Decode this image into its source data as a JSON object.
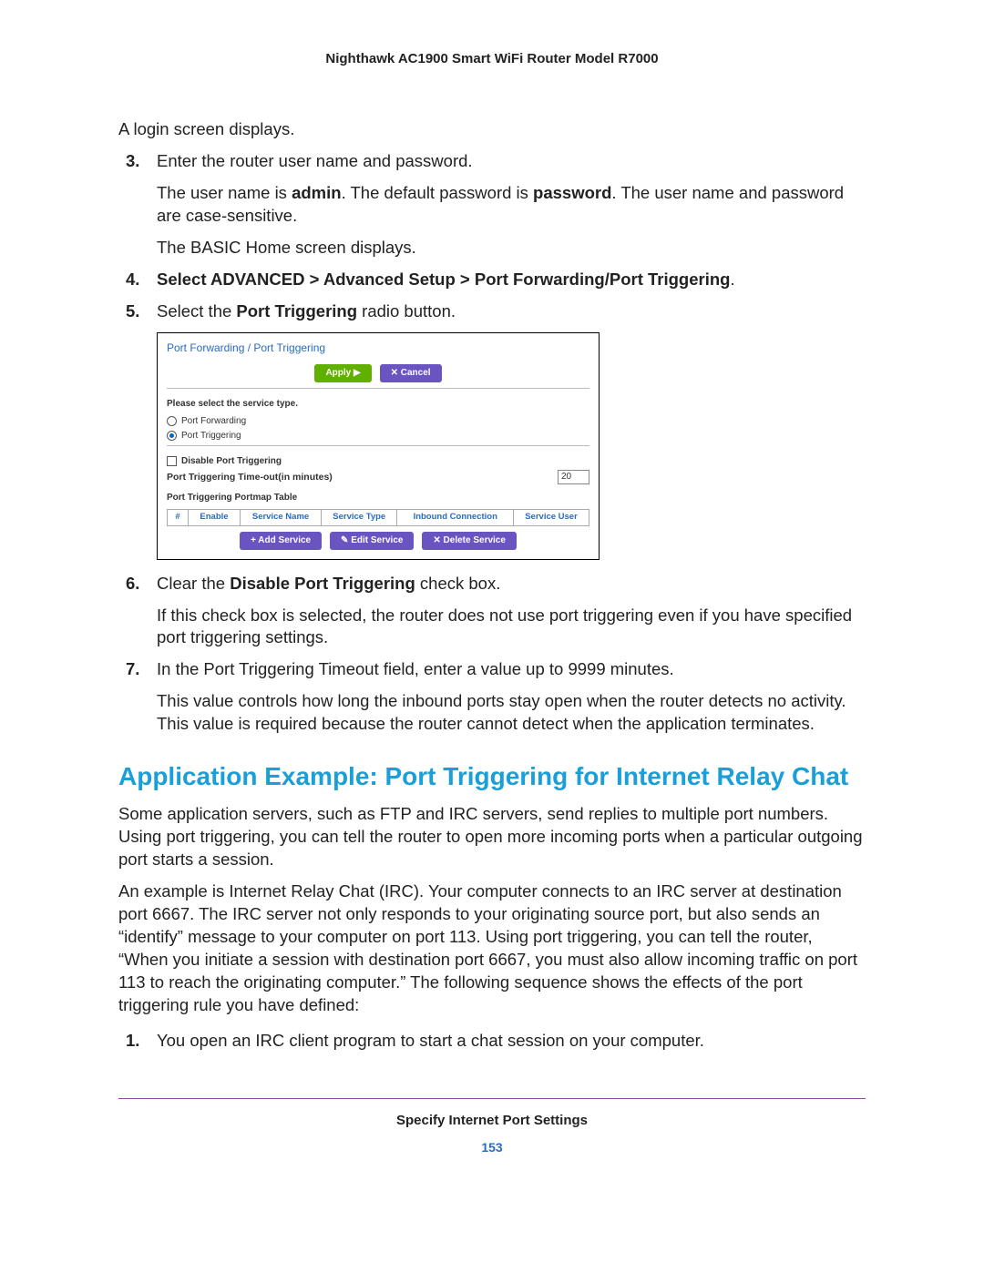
{
  "header": {
    "title": "Nighthawk AC1900 Smart WiFi Router Model R7000"
  },
  "intro": {
    "login_displays": "A login screen displays."
  },
  "steps": {
    "s3": {
      "num": "3.",
      "text": "Enter the router user name and password.",
      "detail_pre": "The user name is ",
      "admin": "admin",
      "detail_mid": ". The default password is ",
      "password": "password",
      "detail_post": ". The user name and password are case-sensitive.",
      "basic": "The BASIC Home screen displays."
    },
    "s4": {
      "num": "4.",
      "pre": "Select ",
      "path": "ADVANCED > Advanced Setup > Port Forwarding/Port Triggering",
      "post": "."
    },
    "s5": {
      "num": "5.",
      "pre": "Select the ",
      "bold": "Port Triggering",
      "post": " radio button."
    },
    "s6": {
      "num": "6.",
      "pre": "Clear the ",
      "bold": "Disable Port Triggering",
      "post": " check box.",
      "detail": "If this check box is selected, the router does not use port triggering even if you have specified port triggering settings."
    },
    "s7": {
      "num": "7.",
      "text": "In the Port Triggering Timeout field, enter a value up to 9999 minutes.",
      "detail": "This value controls how long the inbound ports stay open when the router detects no activity. This value is required because the router cannot detect when the application terminates."
    }
  },
  "figure": {
    "panel_title": "Port Forwarding / Port Triggering",
    "apply": "Apply ▶",
    "cancel": "✕ Cancel",
    "select_service": "Please select the service type.",
    "radio1": "Port Forwarding",
    "radio2": "Port Triggering",
    "disable_label": "Disable Port Triggering",
    "timeout_label": "Port Triggering Time-out(in minutes)",
    "timeout_value": "20",
    "portmap_label": "Port Triggering Portmap Table",
    "cols": {
      "hash": "#",
      "enable": "Enable",
      "service_name": "Service Name",
      "service_type": "Service Type",
      "inbound": "Inbound Connection",
      "service_user": "Service User"
    },
    "add": "+ Add Service",
    "edit": "✎ Edit Service",
    "del": "✕ Delete Service"
  },
  "section": {
    "heading": "Application Example: Port Triggering for Internet Relay Chat",
    "p1": "Some application servers, such as FTP and IRC servers, send replies to multiple port numbers. Using port triggering, you can tell the router to open more incoming ports when a particular outgoing port starts a session.",
    "p2": "An example is Internet Relay Chat (IRC). Your computer connects to an IRC server at destination port 6667. The IRC server not only responds to your originating source port, but also sends an “identify” message to your computer on port 113. Using port triggering, you can tell the router, “When you initiate a session with destination port 6667, you must also allow incoming traffic on port 113 to reach the originating computer.” The following sequence shows the effects of the port triggering rule you have defined:",
    "list1_num": "1.",
    "list1": "You open an IRC client program to start a chat session on your computer."
  },
  "footer": {
    "title": "Specify Internet Port Settings",
    "page": "153"
  }
}
